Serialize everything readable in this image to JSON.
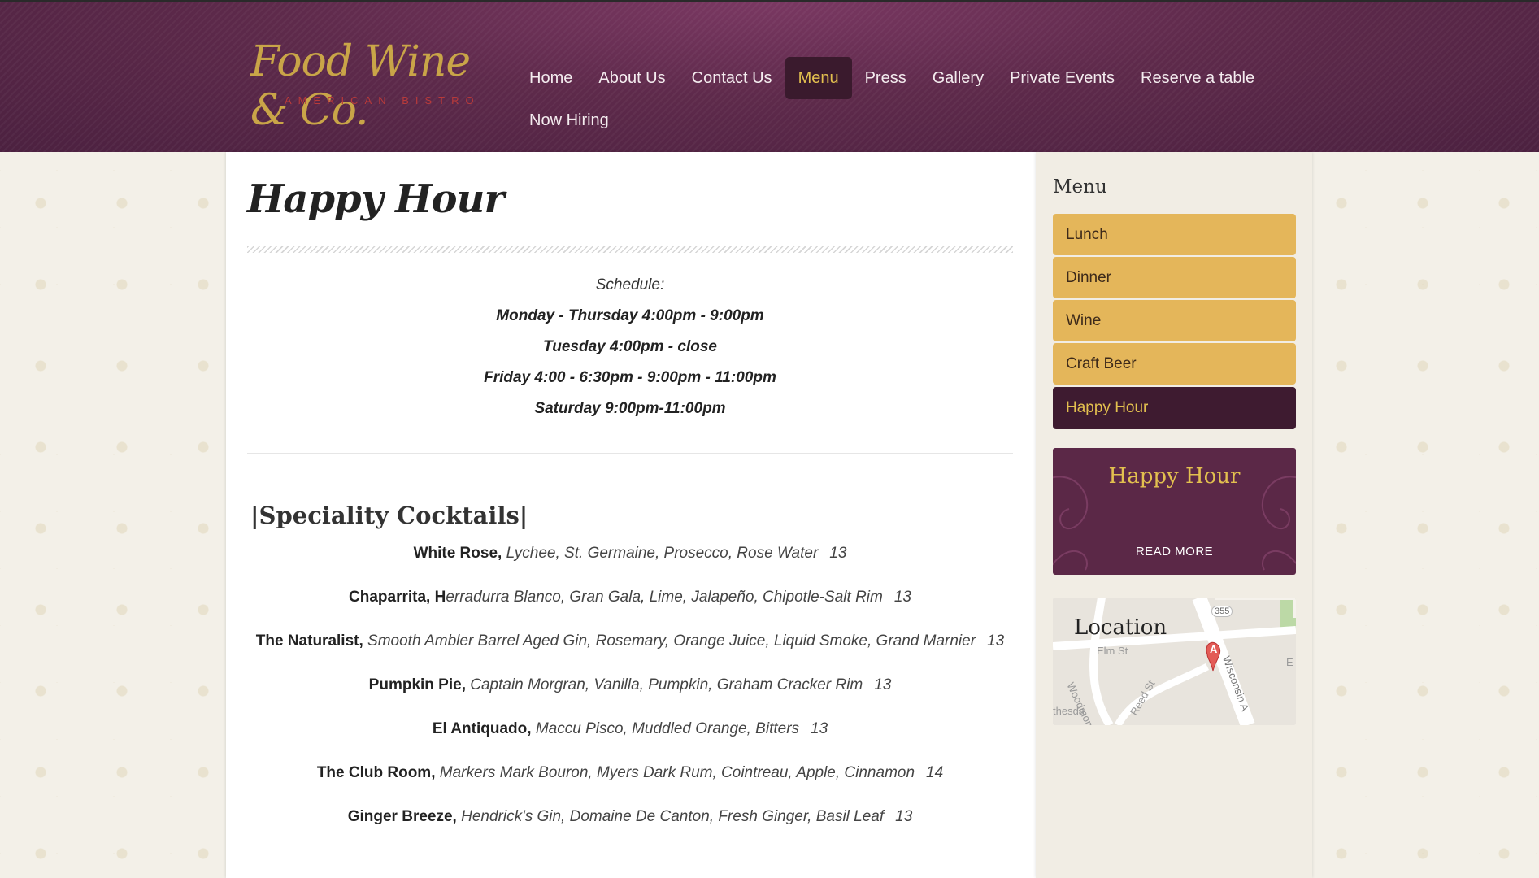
{
  "header": {
    "logo_script": "Food Wine & Co.",
    "logo_sub": "AMERICAN BISTRO",
    "nav": [
      {
        "label": "Home",
        "active": false
      },
      {
        "label": "About Us",
        "active": false
      },
      {
        "label": "Contact Us",
        "active": false
      },
      {
        "label": "Menu",
        "active": true
      },
      {
        "label": "Press",
        "active": false
      },
      {
        "label": "Gallery",
        "active": false
      },
      {
        "label": "Private Events",
        "active": false
      },
      {
        "label": "Reserve a table",
        "active": false
      }
    ],
    "nav_row2": [
      {
        "label": "Now Hiring",
        "active": false
      }
    ]
  },
  "main": {
    "title": "Happy Hour",
    "schedule": {
      "label": "Schedule:",
      "lines": [
        "Monday - Thursday 4:00pm - 9:00pm",
        "Tuesday  4:00pm - close",
        "Friday 4:00 - 6:30pm - 9:00pm - 11:00pm",
        "Saturday 9:00pm-11:00pm"
      ]
    },
    "section_title": "|Speciality Cocktails|",
    "cocktails": [
      {
        "name": "White Rose,",
        "desc": " Lychee, St. Germaine, Prosecco, Rose Water",
        "price": "13"
      },
      {
        "name": "Chaparrita, H",
        "desc": "erradurra Blanco, Gran Gala, Lime, Jalapeño, Chipotle-Salt Rim",
        "price": "13"
      },
      {
        "name": "The Naturalist,",
        "desc": " Smooth Ambler Barrel Aged Gin, Rosemary, Orange Juice, Liquid Smoke, Grand Marnier",
        "price": "13"
      },
      {
        "name": "Pumpkin Pie,",
        "desc": " Captain Morgran, Vanilla, Pumpkin, Graham Cracker Rim",
        "price": "13"
      },
      {
        "name": "El Antiquado,",
        "desc": " Maccu Pisco, Muddled Orange, Bitters",
        "price": "13"
      },
      {
        "name": "The Club Room,",
        "desc": " Markers Mark Bouron, Myers Dark Rum, Cointreau, Apple, Cinnamon",
        "price": "14"
      },
      {
        "name": "Ginger Breeze,",
        "desc": " Hendrick's Gin, Domaine De Canton, Fresh Ginger, Basil Leaf",
        "price": "13"
      }
    ]
  },
  "sidebar": {
    "heading": "Menu",
    "items": [
      {
        "label": "Lunch",
        "active": false
      },
      {
        "label": "Dinner",
        "active": false
      },
      {
        "label": "Wine",
        "active": false
      },
      {
        "label": "Craft Beer",
        "active": false
      },
      {
        "label": "Happy Hour",
        "active": true
      }
    ],
    "promo": {
      "title": "Happy Hour",
      "more": "READ MORE"
    },
    "map": {
      "title": "Location",
      "labels": [
        "Elm St",
        "Woodmont Ave",
        "Reed St",
        "Wisconsin A",
        "thesda",
        "355",
        "E",
        "A"
      ]
    }
  },
  "colors": {
    "header": "#5e2a4b",
    "accent_gold": "#e3c04f",
    "sidebar_item": "#e4b65a",
    "sidebar_active": "#3e1b30"
  }
}
